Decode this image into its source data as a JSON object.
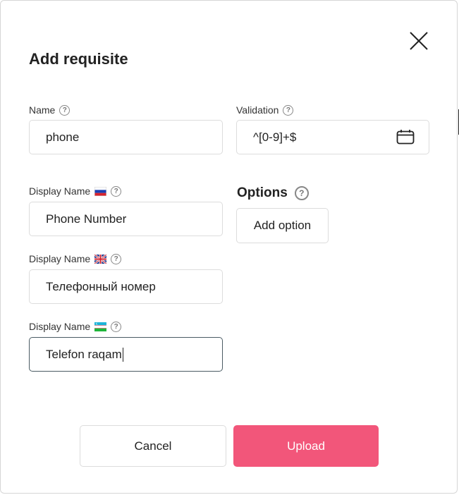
{
  "dialog": {
    "title": "Add requisite",
    "close_icon": "close-icon"
  },
  "name_field": {
    "label": "Name",
    "value": "phone",
    "help_icon": "help-icon"
  },
  "validation_field": {
    "label": "Validation",
    "value": "^[0-9]+$",
    "help_icon": "help-icon",
    "trailing_icon": "calendar-icon"
  },
  "display_names": [
    {
      "label": "Display Name",
      "flag": "russia-flag-icon",
      "value": "Phone Number"
    },
    {
      "label": "Display Name",
      "flag": "uk-flag-icon",
      "value": "Телефонный номер"
    },
    {
      "label": "Display Name",
      "flag": "uzbekistan-flag-icon",
      "value": "Telefon raqam"
    }
  ],
  "options": {
    "title": "Options",
    "help_icon": "help-icon",
    "add_label": "Add option"
  },
  "footer": {
    "cancel_label": "Cancel",
    "upload_label": "Upload"
  },
  "colors": {
    "primary": "#f2567a",
    "border": "#dcdcdc",
    "focused_border": "#4a5b63"
  }
}
